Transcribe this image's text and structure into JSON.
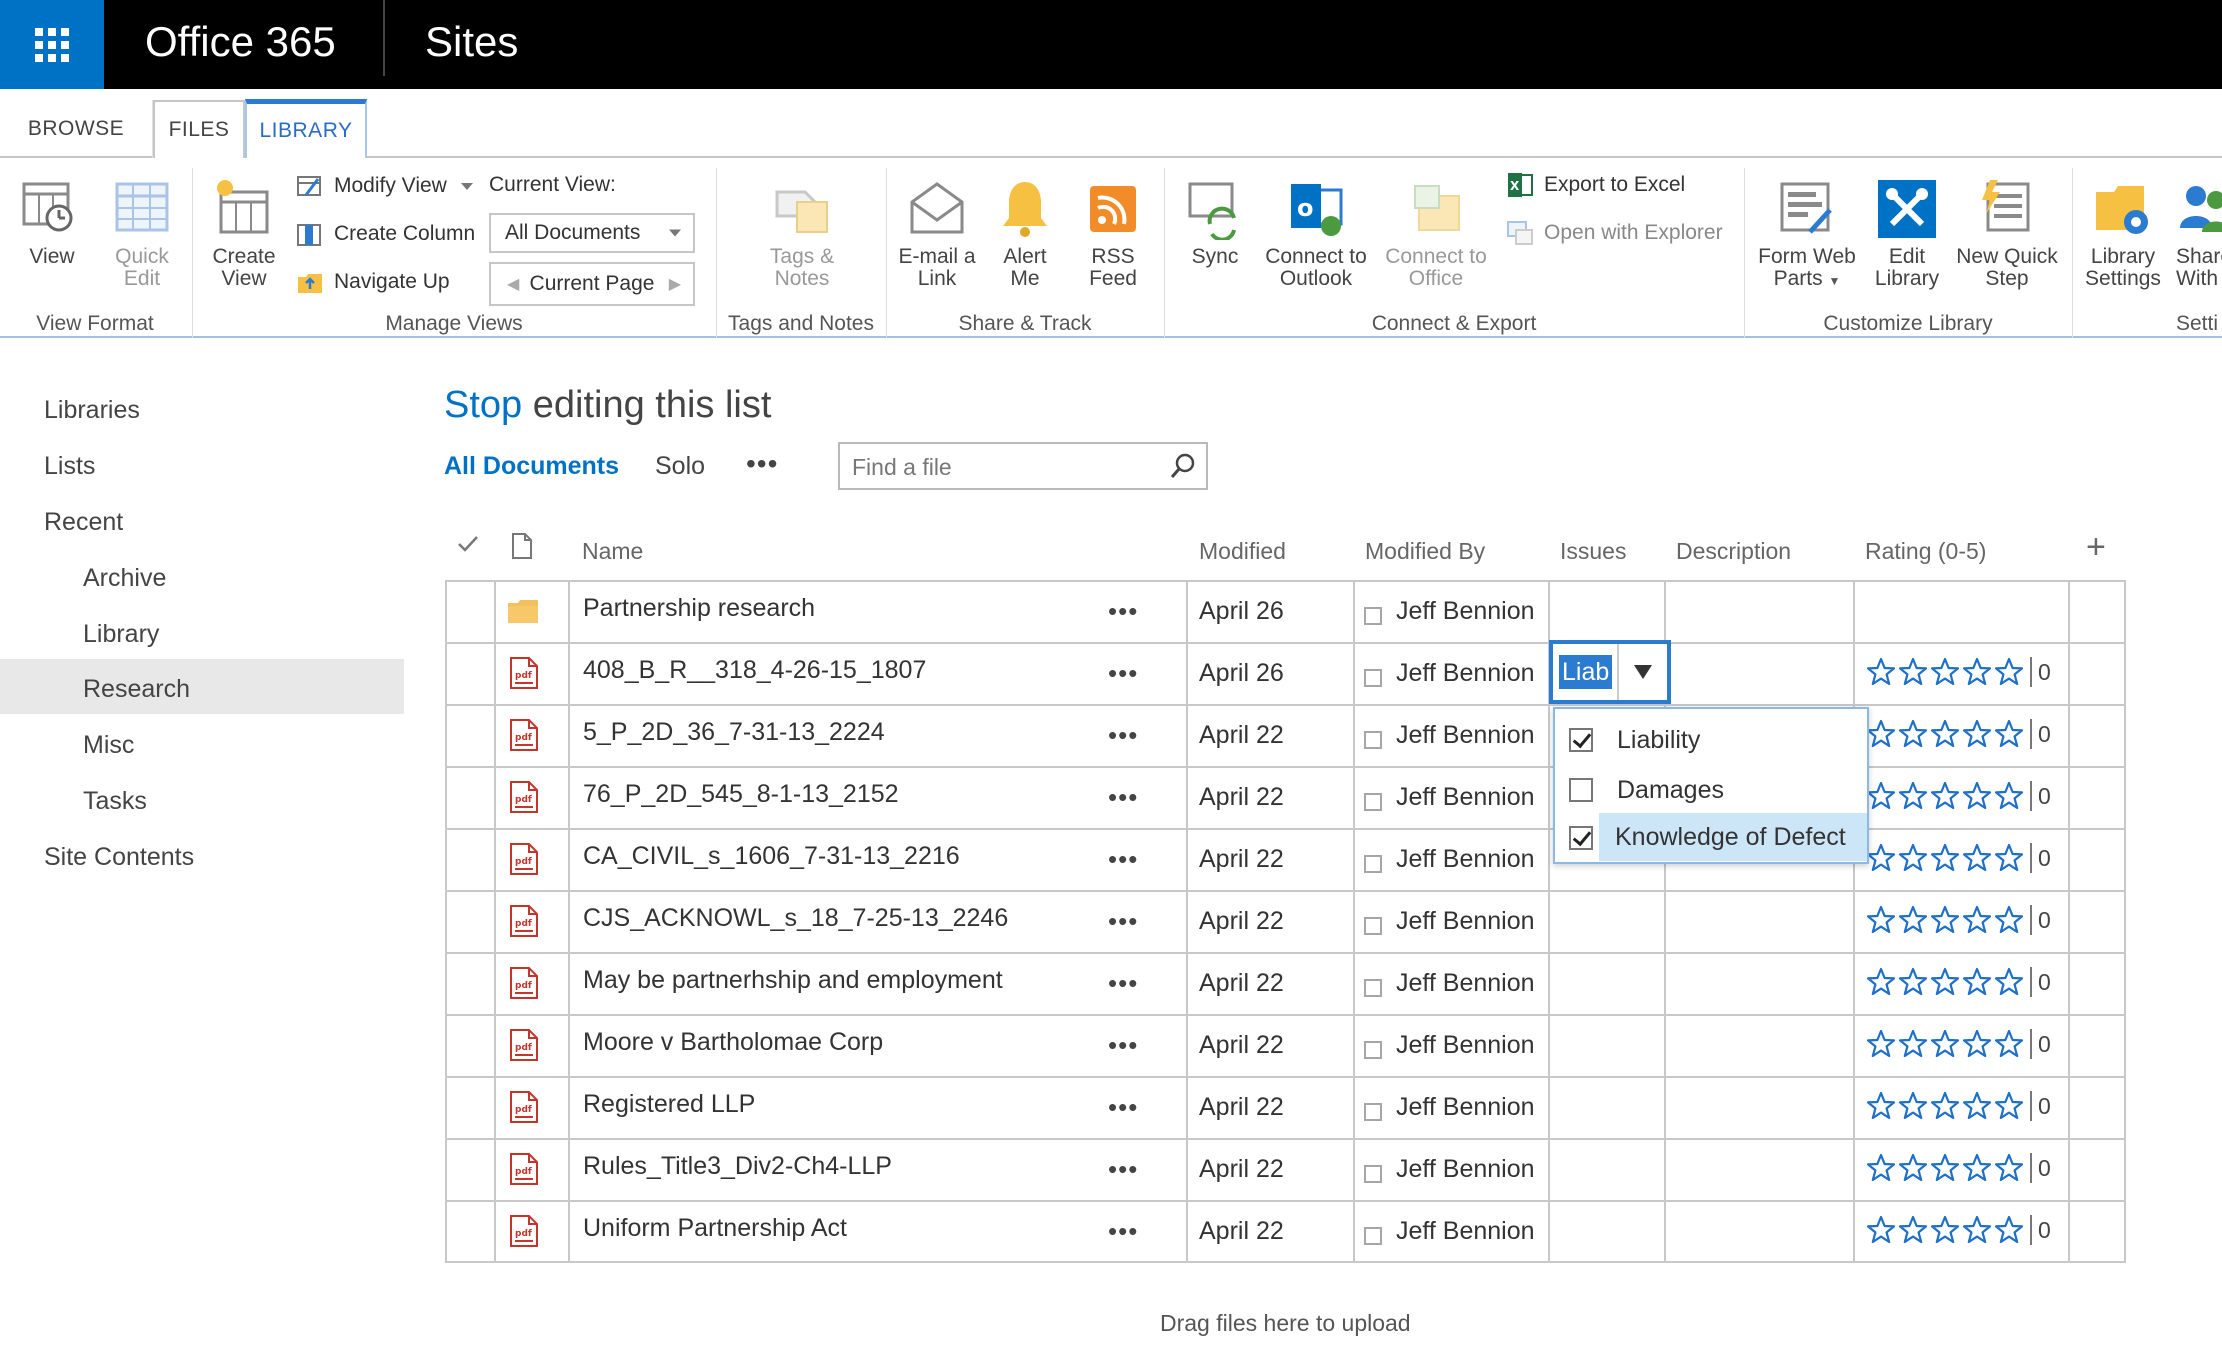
{
  "suite": {
    "brand": "Office 365",
    "app": "Sites"
  },
  "ribbon_tabs": {
    "browse": "BROWSE",
    "files": "FILES",
    "library": "LIBRARY"
  },
  "ribbon": {
    "view": "View",
    "quick_edit": "Quick Edit",
    "create_view": "Create View",
    "modify_view": "Modify View",
    "create_column": "Create Column",
    "navigate_up": "Navigate Up",
    "current_view_label": "Current View:",
    "current_view_value": "All Documents",
    "current_page": "Current Page",
    "tags_notes": "Tags & Notes",
    "email_link": "E-mail a Link",
    "alert_me": "Alert Me",
    "rss_feed": "RSS Feed",
    "sync": "Sync",
    "connect_outlook": "Connect to Outlook",
    "connect_office": "Connect to Office",
    "export_excel": "Export to Excel",
    "open_explorer": "Open with Explorer",
    "form_web_parts": "Form Web Parts",
    "edit_library": "Edit Library",
    "new_quick_step": "New Quick Step",
    "library_settings": "Library Settings",
    "share_with": "Share With",
    "groups": {
      "view_format": "View Format",
      "manage_views": "Manage Views",
      "tags_notes": "Tags and Notes",
      "share_track": "Share & Track",
      "connect_export": "Connect & Export",
      "customize_library": "Customize Library",
      "settings": "Setti"
    }
  },
  "nav": {
    "libraries": "Libraries",
    "lists": "Lists",
    "recent": "Recent",
    "recent_items": [
      "Archive",
      "Library",
      "Research",
      "Misc",
      "Tasks"
    ],
    "site_contents": "Site Contents"
  },
  "main": {
    "title_link": "Stop",
    "title_rest": " editing this list",
    "views": {
      "all": "All Documents",
      "solo": "Solo",
      "more": "•••"
    },
    "search_placeholder": "Find a file",
    "columns": {
      "name": "Name",
      "modified": "Modified",
      "modified_by": "Modified By",
      "issues": "Issues",
      "description": "Description",
      "rating": "Rating (0-5)"
    },
    "add_column": "+",
    "drag_hint": "Drag files here to upload"
  },
  "rows": [
    {
      "name": "Partnership research",
      "modified": "April 26",
      "modified_by": "Jeff Bennion",
      "type": "folder",
      "rating": ""
    },
    {
      "name": "408_B_R__318_4-26-15_1807",
      "modified": "April 26",
      "modified_by": "Jeff Bennion",
      "type": "pdf",
      "rating": "0"
    },
    {
      "name": "5_P_2D_36_7-31-13_2224",
      "modified": "April 22",
      "modified_by": "Jeff Bennion",
      "type": "pdf",
      "rating": "0"
    },
    {
      "name": "76_P_2D_545_8-1-13_2152",
      "modified": "April 22",
      "modified_by": "Jeff Bennion",
      "type": "pdf",
      "rating": "0"
    },
    {
      "name": "CA_CIVIL_s_1606_7-31-13_2216",
      "modified": "April 22",
      "modified_by": "Jeff Bennion",
      "type": "pdf",
      "rating": "0"
    },
    {
      "name": "CJS_ACKNOWL_s_18_7-25-13_2246",
      "modified": "April 22",
      "modified_by": "Jeff Bennion",
      "type": "pdf",
      "rating": "0"
    },
    {
      "name": "May be partnerhship and employment",
      "modified": "April 22",
      "modified_by": "Jeff Bennion",
      "type": "pdf",
      "rating": "0"
    },
    {
      "name": "Moore v Bartholomae Corp",
      "modified": "April 22",
      "modified_by": "Jeff Bennion",
      "type": "pdf",
      "rating": "0"
    },
    {
      "name": "Registered LLP",
      "modified": "April 22",
      "modified_by": "Jeff Bennion",
      "type": "pdf",
      "rating": "0"
    },
    {
      "name": "Rules_Title3_Div2-Ch4-LLP",
      "modified": "April 22",
      "modified_by": "Jeff Bennion",
      "type": "pdf",
      "rating": "0"
    },
    {
      "name": "Uniform Partnership Act",
      "modified": "April 22",
      "modified_by": "Jeff Bennion",
      "type": "pdf",
      "rating": "0"
    }
  ],
  "issues_editor": {
    "value": "Liab",
    "options": [
      {
        "label": "Liability",
        "checked": true
      },
      {
        "label": "Damages",
        "checked": false
      },
      {
        "label": "Knowledge of Defect",
        "checked": true
      }
    ]
  },
  "colors": {
    "suite_bg": "#000000",
    "waffle": "#0072c6",
    "accent": "#2b7bd0",
    "link": "#0072c6",
    "star": "#1e6fc8"
  }
}
